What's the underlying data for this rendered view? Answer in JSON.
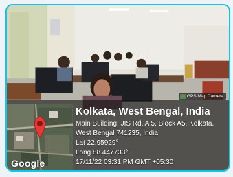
{
  "badge": {
    "label": "GPS Map Camera",
    "icon": "gps-map-camera-icon"
  },
  "map": {
    "brand": "Google",
    "marker_icon": "map-pin-icon",
    "marker_color": "#e53935"
  },
  "location": {
    "title": "Kolkata, West Bengal, India",
    "address_line1": "Main Building, JIS Rd, A 5, Block A5, Kolkata,",
    "address_line2": "West Bengal 741235, India",
    "latitude": "Lat 22.95929°",
    "longitude": "Long 88.447733°",
    "timestamp": "17/11/22 03:31 PM GMT +05:30"
  },
  "colors": {
    "frame_border": "#16c3e6",
    "overlay": "#141414"
  }
}
